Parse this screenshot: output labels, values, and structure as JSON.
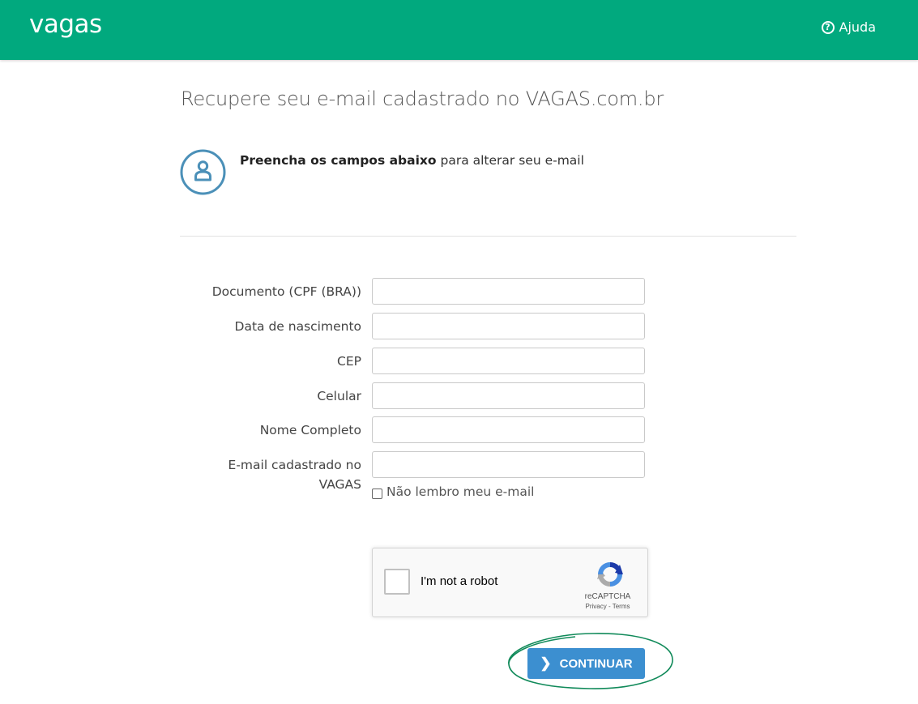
{
  "header": {
    "logo": "vagas",
    "help_label": "Ajuda",
    "help_icon": "?"
  },
  "page": {
    "title": "Recupere seu e-mail cadastrado no VAGAS.com.br",
    "intro_bold": "Preencha os campos abaixo",
    "intro_rest": " para alterar seu e-mail"
  },
  "form": {
    "fields": [
      {
        "label": "Documento (CPF (BRA))",
        "value": ""
      },
      {
        "label": "Data de nascimento",
        "value": ""
      },
      {
        "label": "CEP",
        "value": ""
      },
      {
        "label": "Celular",
        "value": ""
      },
      {
        "label": "Nome Completo",
        "value": ""
      },
      {
        "label": "E-mail cadastrado no VAGAS",
        "value": ""
      }
    ],
    "forgot_email_label": "Não lembro meu e-mail"
  },
  "captcha": {
    "label": "I'm not a robot",
    "brand": "reCAPTCHA",
    "privacy": "Privacy",
    "separator": " - ",
    "terms": "Terms"
  },
  "actions": {
    "continue_label": "CONTINUAR"
  },
  "colors": {
    "brand_green": "#01a97e",
    "button_blue": "#3c8fd0",
    "icon_blue": "#4b90b8",
    "annotation_green": "#118a5a"
  }
}
